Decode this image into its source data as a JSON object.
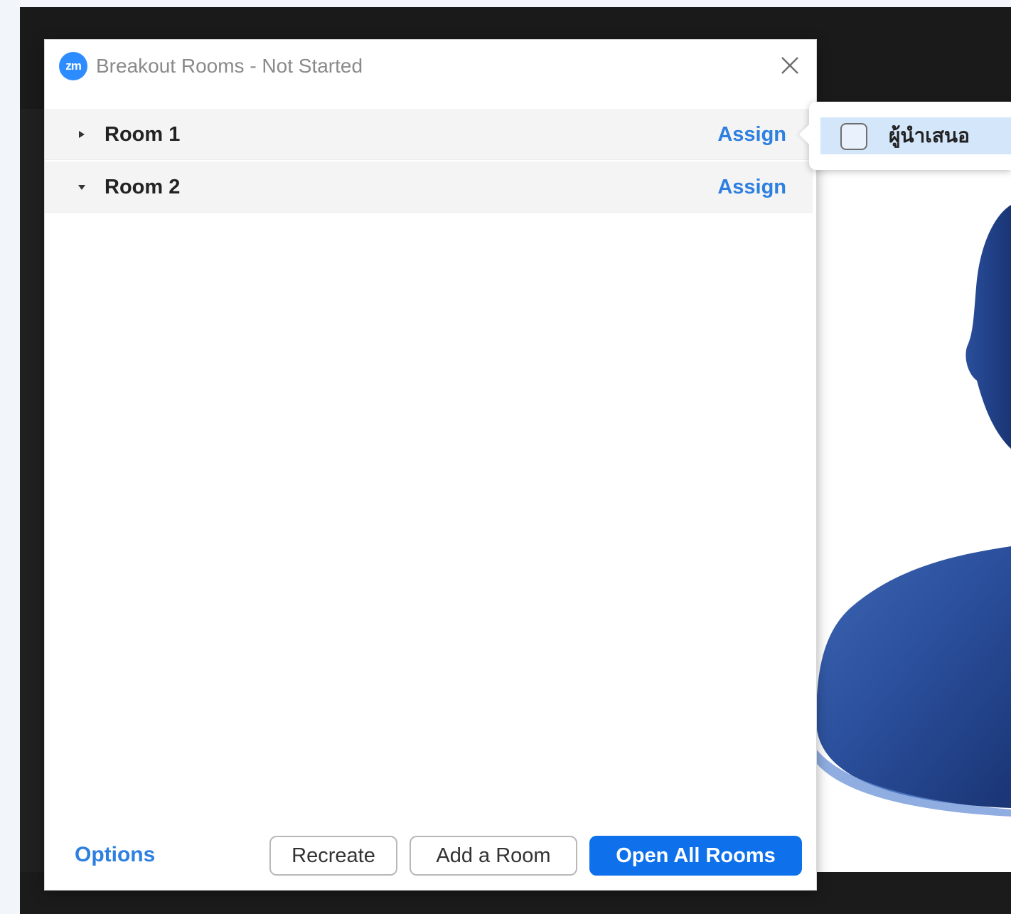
{
  "window": {
    "title": "Breakout Rooms - Not Started",
    "logo_text": "zm",
    "logo_icon": "zoom-logo-icon",
    "close_icon": "close-icon"
  },
  "rooms": [
    {
      "name": "Room 1",
      "expanded": false,
      "assign_label": "Assign"
    },
    {
      "name": "Room 2",
      "expanded": true,
      "assign_label": "Assign"
    }
  ],
  "footer": {
    "options_label": "Options",
    "recreate_label": "Recreate",
    "add_room_label": "Add a Room",
    "open_all_label": "Open All Rooms"
  },
  "assign_popup": {
    "participant": "ผู้นำเสนอ",
    "checked": false
  },
  "colors": {
    "accent": "#2d7fe0",
    "primary_button": "#0e71eb",
    "zoom_logo": "#2d8cff",
    "popup_highlight": "#d4e6fa"
  }
}
